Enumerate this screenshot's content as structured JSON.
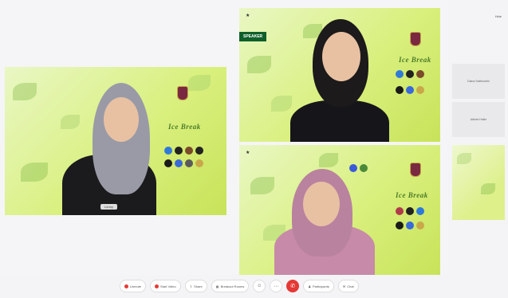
{
  "tiles": {
    "left": {
      "name_tag": "Lenny",
      "event_text": "Ice Break"
    },
    "top_right": {
      "speaker_label": "SPEAKER",
      "pin_icon": "star-icon",
      "event_text": "Ice Break"
    },
    "bottom_right": {
      "pin_icon": "star-icon",
      "event_text": "Ice Break"
    }
  },
  "sidebar": {
    "top_button": "Hide",
    "card_1": "Diana Salehuddin",
    "card_2": "Aishah Halim"
  },
  "toolbar": {
    "unmute": "Unmute",
    "start_video": "Start Video",
    "share": "Share",
    "breakout": "Breakout Rooms",
    "participants": "Participants",
    "chat": "Chat"
  },
  "colors": {
    "leave": "#e53935",
    "speaker_tag": "#0f5f2a",
    "tile_bg": "#d9f07e"
  }
}
